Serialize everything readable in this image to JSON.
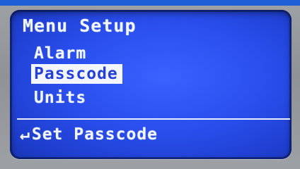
{
  "screen": {
    "title": "Menu Setup",
    "menu_items": [
      {
        "label": "Alarm",
        "selected": false
      },
      {
        "label": "Passcode",
        "selected": true
      },
      {
        "label": "Units",
        "selected": false
      }
    ],
    "footer": {
      "icon": "enter-return-icon",
      "icon_glyph": "↵",
      "label": "Set Passcode"
    }
  },
  "colors": {
    "lcd_background": "#2a4fee",
    "text": "#f2f6ff",
    "highlight_background": "#f3f6ff",
    "highlight_text": "#2340d8",
    "bezel": "#8f9296"
  }
}
